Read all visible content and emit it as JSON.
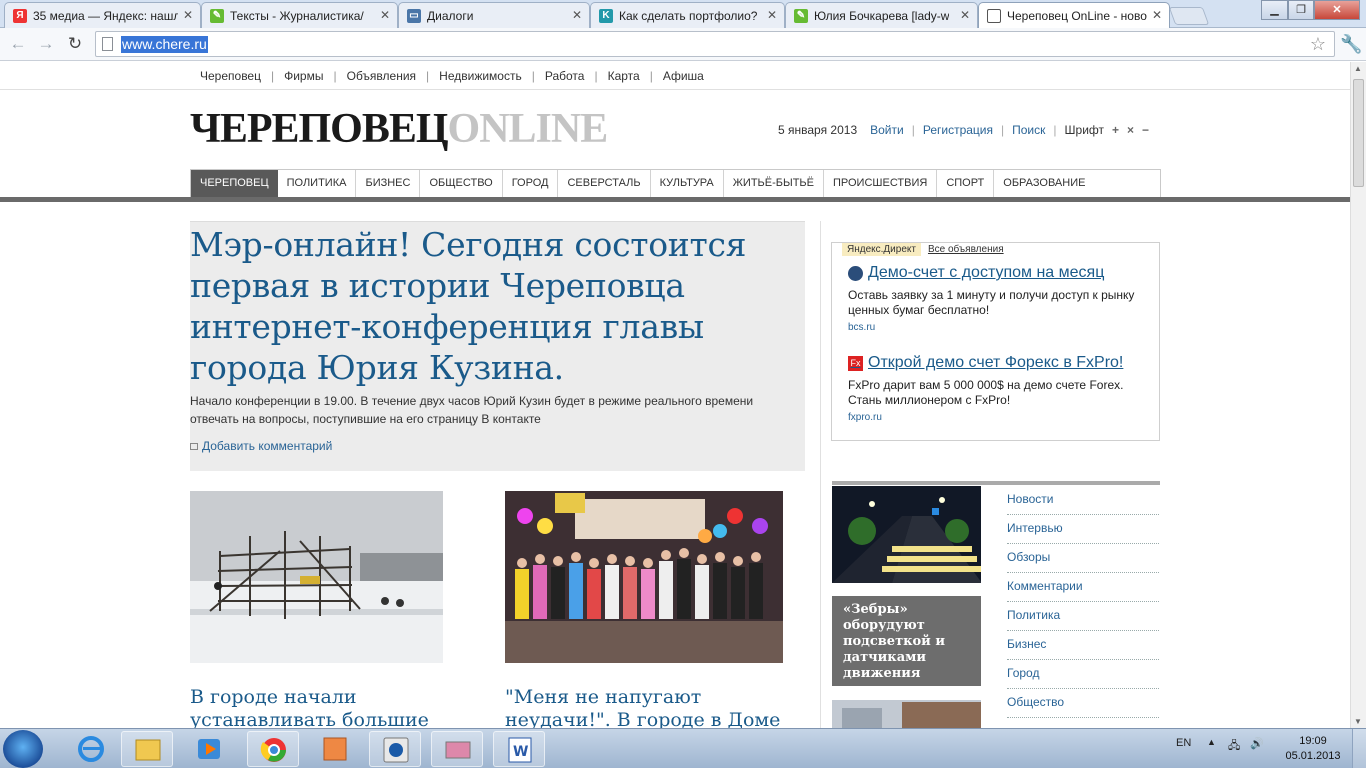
{
  "tabs": [
    {
      "title": "35 медиа — Яндекс: нашл",
      "icon": "yandex-icon",
      "color": "#e33"
    },
    {
      "title": "Тексты - Журналистика/",
      "icon": "feather-icon",
      "color": "#6b3"
    },
    {
      "title": "Диалоги",
      "icon": "vk-icon",
      "color": "#4a76a8"
    },
    {
      "title": "Как сделать портфолио?",
      "icon": "k-icon",
      "color": "#29a"
    },
    {
      "title": "Юлия Бочкарева [lady-w",
      "icon": "feather-icon",
      "color": "#6b3"
    },
    {
      "title": "Череповец OnLine - ново",
      "icon": "page-icon",
      "color": "#555"
    }
  ],
  "address": {
    "url": "www.chere.ru"
  },
  "topnav": [
    "Череповец",
    "Фирмы",
    "Объявления",
    "Недвижимость",
    "Работа",
    "Карта",
    "Афиша"
  ],
  "logo": {
    "part1": "ЧЕРЕПОВЕЦ",
    "part2": "ONLINE"
  },
  "header": {
    "date": "5 января 2013",
    "login": "Войти",
    "register": "Регистрация",
    "search": "Поиск",
    "font_label": "Шрифт",
    "font_plus": "+",
    "font_x": "×",
    "font_minus": "−"
  },
  "menu": [
    "ЧЕРЕПОВЕЦ",
    "ПОЛИТИКА",
    "БИЗНЕС",
    "ОБЩЕСТВО",
    "ГОРОД",
    "СЕВЕРСТАЛЬ",
    "КУЛЬТУРА",
    "ЖИТЬЁ-БЫТЬЁ",
    "ПРОИСШЕСТВИЯ",
    "СПОРТ",
    "ОБРАЗОВАНИЕ"
  ],
  "lead": {
    "title": "Мэр-онлайн! Сегодня состоится первая в истории Череповца интернет-конференция главы города Юрия Кузина.",
    "text": "Начало конференции в 19.00. В течение двух часов Юрий Кузин будет в режиме реального времени отвечать на вопросы, поступившие на его страницу В контакте",
    "comment": "Добавить комментарий"
  },
  "stories": [
    {
      "title": "В городе начали устанавливать большие"
    },
    {
      "title": "\"Меня не напугают неудачи!\". В городе в Доме знаний"
    }
  ],
  "ad": {
    "brand": "Яндекс.Директ",
    "all": "Все объявления",
    "items": [
      {
        "title": "Демо-счет с доступом на месяц",
        "text": "Оставь заявку за 1 минуту и получи доступ к рынку ценных бумаг бесплатно!",
        "url": "bcs.ru"
      },
      {
        "title": "Открой демо счет Форекс в FxPro!",
        "text": "FxPro дарит вам 5 000 000$ на демо счете Forex. Стань миллионером с FxPro!",
        "url": "fxpro.ru",
        "badge": "Fx"
      }
    ]
  },
  "side_story": {
    "caption": "«Зебры» оборудуют подсветкой и датчиками движения"
  },
  "right_nav": [
    "Новости",
    "Интервью",
    "Обзоры",
    "Комментарии",
    "Политика",
    "Бизнес",
    "Город",
    "Общество"
  ],
  "taskbar": {
    "lang": "EN",
    "time": "19:09",
    "date": "05.01.2013"
  }
}
